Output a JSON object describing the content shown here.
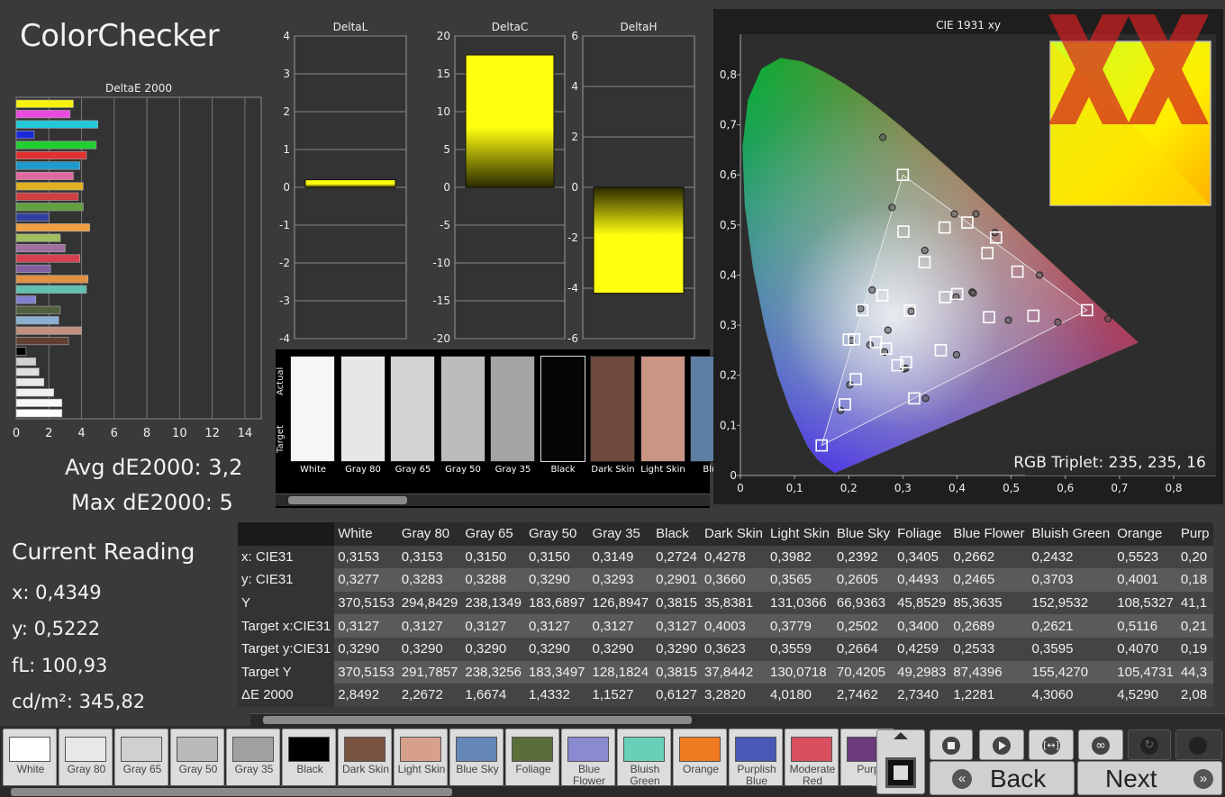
{
  "title": "ColorChecker",
  "deltae_panel": {
    "chart_title": "DeltaE 2000",
    "avg_label": "Avg dE2000: 3,2",
    "max_label": "Max dE2000: 5"
  },
  "current_reading": {
    "heading": "Current Reading",
    "x": "x: 0,4349",
    "y": "y: 0,5222",
    "fl": "fL: 100,93",
    "cdm2": "cd/m²: 345,82"
  },
  "strip": {
    "actual_label": "Actual",
    "target_label": "Target",
    "swatches": [
      {
        "name": "White",
        "color": "#f7f6f5"
      },
      {
        "name": "Gray 80",
        "color": "#e7e7e7"
      },
      {
        "name": "Gray 65",
        "color": "#d2d2d2"
      },
      {
        "name": "Gray 50",
        "color": "#bcbcbc"
      },
      {
        "name": "Gray 35",
        "color": "#a4a4a4"
      },
      {
        "name": "Black",
        "color": "#050505"
      },
      {
        "name": "Dark Skin",
        "color": "#6e4a3d"
      },
      {
        "name": "Light Skin",
        "color": "#c99585"
      },
      {
        "name": "Blue",
        "color": "#5e7ea3"
      }
    ]
  },
  "rgb_triplet": "RGB Triplet: 235, 235, 16",
  "table": {
    "columns": [
      "White",
      "Gray 80",
      "Gray 65",
      "Gray 50",
      "Gray 35",
      "Black",
      "Dark Skin",
      "Light Skin",
      "Blue Sky",
      "Foliage",
      "Blue Flower",
      "Bluish Green",
      "Orange",
      "Purp"
    ],
    "rows": [
      {
        "label": "x: CIE31",
        "values": [
          "0,3153",
          "0,3153",
          "0,3150",
          "0,3150",
          "0,3149",
          "0,2724",
          "0,4278",
          "0,3982",
          "0,2392",
          "0,3405",
          "0,2662",
          "0,2432",
          "0,5523",
          "0,20"
        ]
      },
      {
        "label": "y: CIE31",
        "values": [
          "0,3277",
          "0,3283",
          "0,3288",
          "0,3290",
          "0,3293",
          "0,2901",
          "0,3660",
          "0,3565",
          "0,2605",
          "0,4493",
          "0,2465",
          "0,3703",
          "0,4001",
          "0,18"
        ]
      },
      {
        "label": "Y",
        "values": [
          "370,5153",
          "294,8429",
          "238,1349",
          "183,6897",
          "126,8947",
          "0,3815",
          "35,8381",
          "131,0366",
          "66,9363",
          "45,8529",
          "85,3635",
          "152,9532",
          "108,5327",
          "41,1"
        ]
      },
      {
        "label": "Target x:CIE31",
        "values": [
          "0,3127",
          "0,3127",
          "0,3127",
          "0,3127",
          "0,3127",
          "0,3127",
          "0,4003",
          "0,3779",
          "0,2502",
          "0,3400",
          "0,2689",
          "0,2621",
          "0,5116",
          "0,21"
        ]
      },
      {
        "label": "Target y:CIE31",
        "values": [
          "0,3290",
          "0,3290",
          "0,3290",
          "0,3290",
          "0,3290",
          "0,3290",
          "0,3623",
          "0,3559",
          "0,2664",
          "0,4259",
          "0,2533",
          "0,3595",
          "0,4070",
          "0,19"
        ]
      },
      {
        "label": "Target Y",
        "values": [
          "370,5153",
          "291,7857",
          "238,3256",
          "183,3497",
          "128,1824",
          "0,3815",
          "37,8442",
          "130,0718",
          "70,4205",
          "49,2983",
          "87,4396",
          "155,4270",
          "105,4731",
          "44,3"
        ]
      },
      {
        "label": "ΔE 2000",
        "values": [
          "2,8492",
          "2,2672",
          "1,6674",
          "1,4332",
          "1,1527",
          "0,6127",
          "3,2820",
          "4,0180",
          "2,7462",
          "2,7340",
          "1,2281",
          "4,3060",
          "4,5290",
          "2,08"
        ]
      }
    ]
  },
  "bottom_swatches": [
    {
      "name": "White",
      "color": "#ffffff"
    },
    {
      "name": "Gray 80",
      "color": "#e8e8e8"
    },
    {
      "name": "Gray 65",
      "color": "#d0d0d0"
    },
    {
      "name": "Gray 50",
      "color": "#bababa"
    },
    {
      "name": "Gray 35",
      "color": "#a0a0a0"
    },
    {
      "name": "Black",
      "color": "#000000"
    },
    {
      "name": "Dark Skin",
      "color": "#7a5240"
    },
    {
      "name": "Light Skin",
      "color": "#d6a08a"
    },
    {
      "name": "Blue Sky",
      "color": "#6688b8"
    },
    {
      "name": "Foliage",
      "color": "#5a6e3a"
    },
    {
      "name": "Blue Flower",
      "color": "#8a8ad0"
    },
    {
      "name": "Bluish Green",
      "color": "#66d0b8"
    },
    {
      "name": "Orange",
      "color": "#f07a20"
    },
    {
      "name": "Purplish Blue",
      "color": "#4a58b8"
    },
    {
      "name": "Moderate Red",
      "color": "#d85060"
    },
    {
      "name": "Purp",
      "color": "#6a3a7a"
    }
  ],
  "nav": {
    "back": "Back",
    "next": "Next"
  },
  "chart_data": [
    {
      "type": "bar",
      "title": "DeltaE 2000",
      "orientation": "horizontal",
      "xlim": [
        0,
        15
      ],
      "xticks": [
        0,
        2,
        4,
        6,
        8,
        10,
        12,
        14
      ],
      "colors": [
        "#f7f30d",
        "#e84ae0",
        "#20c8d8",
        "#1a2ad8",
        "#20d030",
        "#e03030",
        "#1e9ad0",
        "#e06aa0",
        "#e0b020",
        "#d04040",
        "#60a040",
        "#3040a0",
        "#f0a040",
        "#a0c060",
        "#a070a0",
        "#d84050",
        "#8060a0",
        "#e09040",
        "#60c0b0",
        "#8080d0",
        "#506040",
        "#8ab0d0",
        "#c09080",
        "#604030",
        "#000000",
        "#d0d0d0",
        "#e0e0e0",
        "#e8e8e8",
        "#f0f0f0",
        "#f8f8f8",
        "#ffffff"
      ],
      "values": [
        3.5,
        3.3,
        5.0,
        1.1,
        4.9,
        4.3,
        3.9,
        3.5,
        4.1,
        3.8,
        4.1,
        2.0,
        4.5,
        2.7,
        3.0,
        3.9,
        2.1,
        4.4,
        4.3,
        1.2,
        2.7,
        2.6,
        4.0,
        3.2,
        0.6,
        1.2,
        1.4,
        1.7,
        2.3,
        2.8,
        2.8
      ]
    },
    {
      "type": "bar",
      "title": "DeltaL",
      "categories": [
        "Yellow"
      ],
      "values": [
        0.2
      ],
      "ylim": [
        -4,
        4
      ],
      "yticks": [
        4,
        3,
        2,
        1,
        0,
        -1,
        -2,
        -3,
        -4
      ]
    },
    {
      "type": "bar",
      "title": "DeltaC",
      "categories": [
        "Yellow"
      ],
      "values": [
        17.5
      ],
      "ylim": [
        -20,
        20
      ],
      "yticks": [
        20,
        15,
        10,
        5,
        0,
        -5,
        -10,
        -15,
        -20
      ]
    },
    {
      "type": "bar",
      "title": "DeltaH",
      "categories": [
        "Yellow"
      ],
      "values": [
        -4.2
      ],
      "ylim": [
        -6,
        6
      ],
      "yticks": [
        6,
        4,
        2,
        0,
        -2,
        -4,
        -6
      ]
    },
    {
      "type": "scatter",
      "title": "CIE 1931 xy",
      "xlim": [
        0,
        0.85
      ],
      "ylim": [
        0,
        0.85
      ],
      "xticks": [
        "0",
        "0,1",
        "0,2",
        "0,3",
        "0,4",
        "0,5",
        "0,6",
        "0,7",
        "0,8"
      ],
      "yticks": [
        "0",
        "0,1",
        "0,2",
        "0,3",
        "0,4",
        "0,5",
        "0,6",
        "0,7",
        "0,8"
      ],
      "gamut_triangle": [
        [
          0.64,
          0.33
        ],
        [
          0.3,
          0.6
        ],
        [
          0.15,
          0.06
        ]
      ],
      "targets": [
        [
          0.3127,
          0.329
        ],
        [
          0.4003,
          0.3623
        ],
        [
          0.3779,
          0.3559
        ],
        [
          0.2502,
          0.2664
        ],
        [
          0.34,
          0.4259
        ],
        [
          0.2689,
          0.2533
        ],
        [
          0.2621,
          0.3595
        ],
        [
          0.5116,
          0.407
        ],
        [
          0.2131,
          0.1924
        ],
        [
          0.459,
          0.316
        ],
        [
          0.306,
          0.226
        ],
        [
          0.377,
          0.495
        ],
        [
          0.472,
          0.475
        ],
        [
          0.193,
          0.142
        ],
        [
          0.301,
          0.487
        ],
        [
          0.541,
          0.319
        ],
        [
          0.456,
          0.444
        ],
        [
          0.2,
          0.271
        ],
        [
          0.64,
          0.33
        ],
        [
          0.3,
          0.6
        ],
        [
          0.15,
          0.06
        ],
        [
          0.225,
          0.33
        ],
        [
          0.419,
          0.505
        ],
        [
          0.321,
          0.154
        ],
        [
          0.37,
          0.25
        ],
        [
          0.21,
          0.272
        ],
        [
          0.29,
          0.22
        ]
      ],
      "measured": [
        [
          0.3153,
          0.3277
        ],
        [
          0.4278,
          0.366
        ],
        [
          0.3982,
          0.3565
        ],
        [
          0.2392,
          0.2605
        ],
        [
          0.3405,
          0.4493
        ],
        [
          0.2662,
          0.2465
        ],
        [
          0.2432,
          0.3703
        ],
        [
          0.5523,
          0.4001
        ],
        [
          0.202,
          0.181
        ],
        [
          0.495,
          0.31
        ],
        [
          0.302,
          0.213
        ],
        [
          0.395,
          0.522
        ],
        [
          0.4349,
          0.5222
        ],
        [
          0.185,
          0.13
        ],
        [
          0.28,
          0.535
        ],
        [
          0.586,
          0.306
        ],
        [
          0.47,
          0.485
        ],
        [
          0.205,
          0.269
        ],
        [
          0.679,
          0.313
        ],
        [
          0.263,
          0.675
        ],
        [
          0.2724,
          0.2901
        ],
        [
          0.222,
          0.333
        ],
        [
          0.399,
          0.241
        ],
        [
          0.342,
          0.154
        ],
        [
          0.305,
          0.214
        ],
        [
          0.43,
          0.364
        ]
      ]
    }
  ]
}
